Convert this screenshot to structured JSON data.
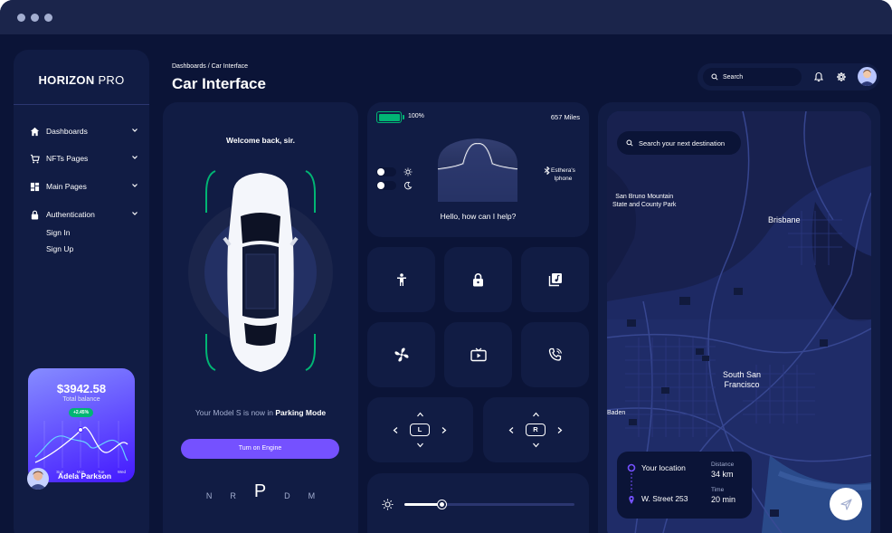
{
  "sidebar": {
    "brand_bold": "HORIZON",
    "brand_light": " PRO",
    "items": [
      {
        "label": "Dashboards",
        "icon": "home-icon"
      },
      {
        "label": "NFTs Pages",
        "icon": "cart-icon"
      },
      {
        "label": "Main Pages",
        "icon": "dashboard-grid-icon"
      },
      {
        "label": "Authentication",
        "icon": "lock-icon"
      }
    ],
    "sub_items": [
      "Sign In",
      "Sign Up"
    ],
    "balance": {
      "amount": "$3942.58",
      "label": "Total balance",
      "badge": "+2.45%",
      "days": [
        "Sat",
        "Sun",
        "Mon",
        "Tue",
        "Wed"
      ]
    },
    "user": {
      "name": "Adela Parkson"
    }
  },
  "header": {
    "breadcrumb": "Dashboards / Car Interface",
    "title": "Car Interface",
    "search_placeholder": "Search"
  },
  "car": {
    "welcome": "Welcome back, sir.",
    "status_prefix": "Your Model S is now in ",
    "status_mode": "Parking Mode",
    "engine_button": "Turn on Engine",
    "gears": [
      "N",
      "R",
      "P",
      "D",
      "M"
    ],
    "active_gear": "P"
  },
  "assistant": {
    "battery_pct": "100%",
    "battery_level": 1.0,
    "range": "657 Miles",
    "bluetooth_device_line1": "Esthera's",
    "bluetooth_device_line2": "Iphone",
    "prompt": "Hello, how can I help?"
  },
  "controls": {
    "tiles": [
      "child-seat-icon",
      "lock-icon",
      "music-note-icon",
      "fan-icon",
      "tv-icon",
      "phone-call-icon"
    ],
    "left_dpad_label": "L",
    "right_dpad_label": "R",
    "brightness_level": 0.22
  },
  "map": {
    "search_placeholder": "Search your next destination",
    "labels": {
      "san_bruno_1": "San Bruno Mountain",
      "san_bruno_2": "State and County Park",
      "brisbane": "Brisbane",
      "sf_1": "South San",
      "sf_2": "Francisco",
      "baden": "Baden"
    },
    "trip": {
      "from": "Your location",
      "to": "W. Street 253",
      "distance_label": "Distance",
      "distance_value": "34 km",
      "time_label": "Time",
      "time_value": "20 min"
    }
  },
  "colors": {
    "background": "#0b1437",
    "panel": "#111c44",
    "accent": "#7551ff",
    "success": "#01b574"
  }
}
